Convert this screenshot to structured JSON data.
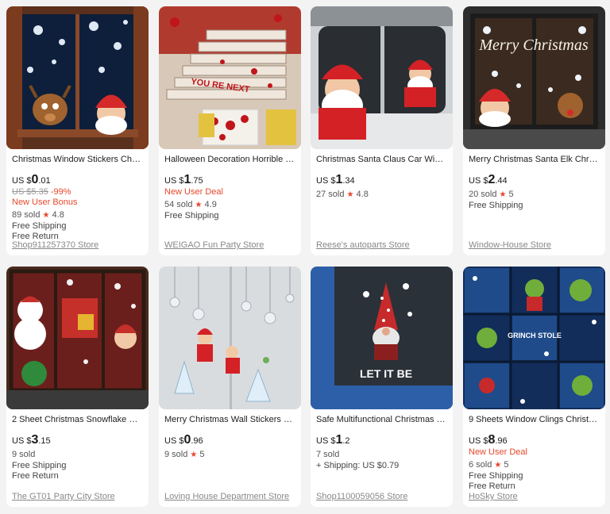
{
  "colors": {
    "accent": "#e8472b",
    "page_bg": "#f3f3f3",
    "card_bg": "#ffffff"
  },
  "products": [
    {
      "title": "Christmas Window Stickers Christ...",
      "currency": "US $",
      "price_main": "0",
      "price_dec": ".01",
      "old_price": "US $5.35",
      "discount": "-99%",
      "promo": "New User Bonus",
      "sold": "89 sold",
      "rating": "4.8",
      "shipping": "Free Shipping",
      "returns": "Free Return",
      "store": "Shop911257370 Store",
      "image_icon": "christmas-window-image"
    },
    {
      "title": "Halloween Decoration Horrible Blo...",
      "currency": "US $",
      "price_main": "1",
      "price_dec": ".75",
      "promo": "New User Deal",
      "sold": "54 sold",
      "rating": "4.9",
      "shipping": "Free Shipping",
      "store": "WEIGAO Fun Party Store",
      "image_icon": "halloween-stairs-image"
    },
    {
      "title": "Christmas Santa Claus Car Windo...",
      "currency": "US $",
      "price_main": "1",
      "price_dec": ".34",
      "sold": "27 sold",
      "rating": "4.8",
      "store": "Reese's autoparts Store",
      "image_icon": "santa-car-image"
    },
    {
      "title": "Merry Christmas Santa Elk Christm...",
      "currency": "US $",
      "price_main": "2",
      "price_dec": ".44",
      "sold": "20 sold",
      "rating": "5",
      "shipping": "Free Shipping",
      "store": "Window-House Store",
      "image_icon": "merry-christmas-window-image",
      "image_text": "Merry Christmas"
    },
    {
      "title": "2 Sheet Christmas Snowflake Wind...",
      "currency": "US $",
      "price_main": "3",
      "price_dec": ".15",
      "sold": "9 sold",
      "shipping": "Free Shipping",
      "returns": "Free Return",
      "store": "The GT01 Party City Store",
      "image_icon": "snowflake-shop-window-image"
    },
    {
      "title": "Merry Christmas Wall Stickers Sant...",
      "currency": "US $",
      "price_main": "0",
      "price_dec": ".96",
      "sold": "9 sold",
      "rating": "5",
      "store": "Loving House Department Store",
      "image_icon": "wall-stickers-image"
    },
    {
      "title": "Safe Multifunctional Christmas Gn...",
      "currency": "US $",
      "price_main": "1",
      "price_dec": ".2",
      "sold": "7 sold",
      "shipping": "+ Shipping: US $0.79",
      "store": "Shop1100059056 Store",
      "image_icon": "gnome-car-image",
      "image_text": "LET IT BE"
    },
    {
      "title": "9 Sheets Window Clings Christmas...",
      "currency": "US $",
      "price_main": "8",
      "price_dec": ".96",
      "promo": "New User Deal",
      "sold": "6 sold",
      "rating": "5",
      "shipping": "Free Shipping",
      "returns": "Free Return",
      "store": "HoSky Store",
      "image_icon": "grinch-clings-image",
      "image_text": "GRINCH STOLE"
    }
  ]
}
